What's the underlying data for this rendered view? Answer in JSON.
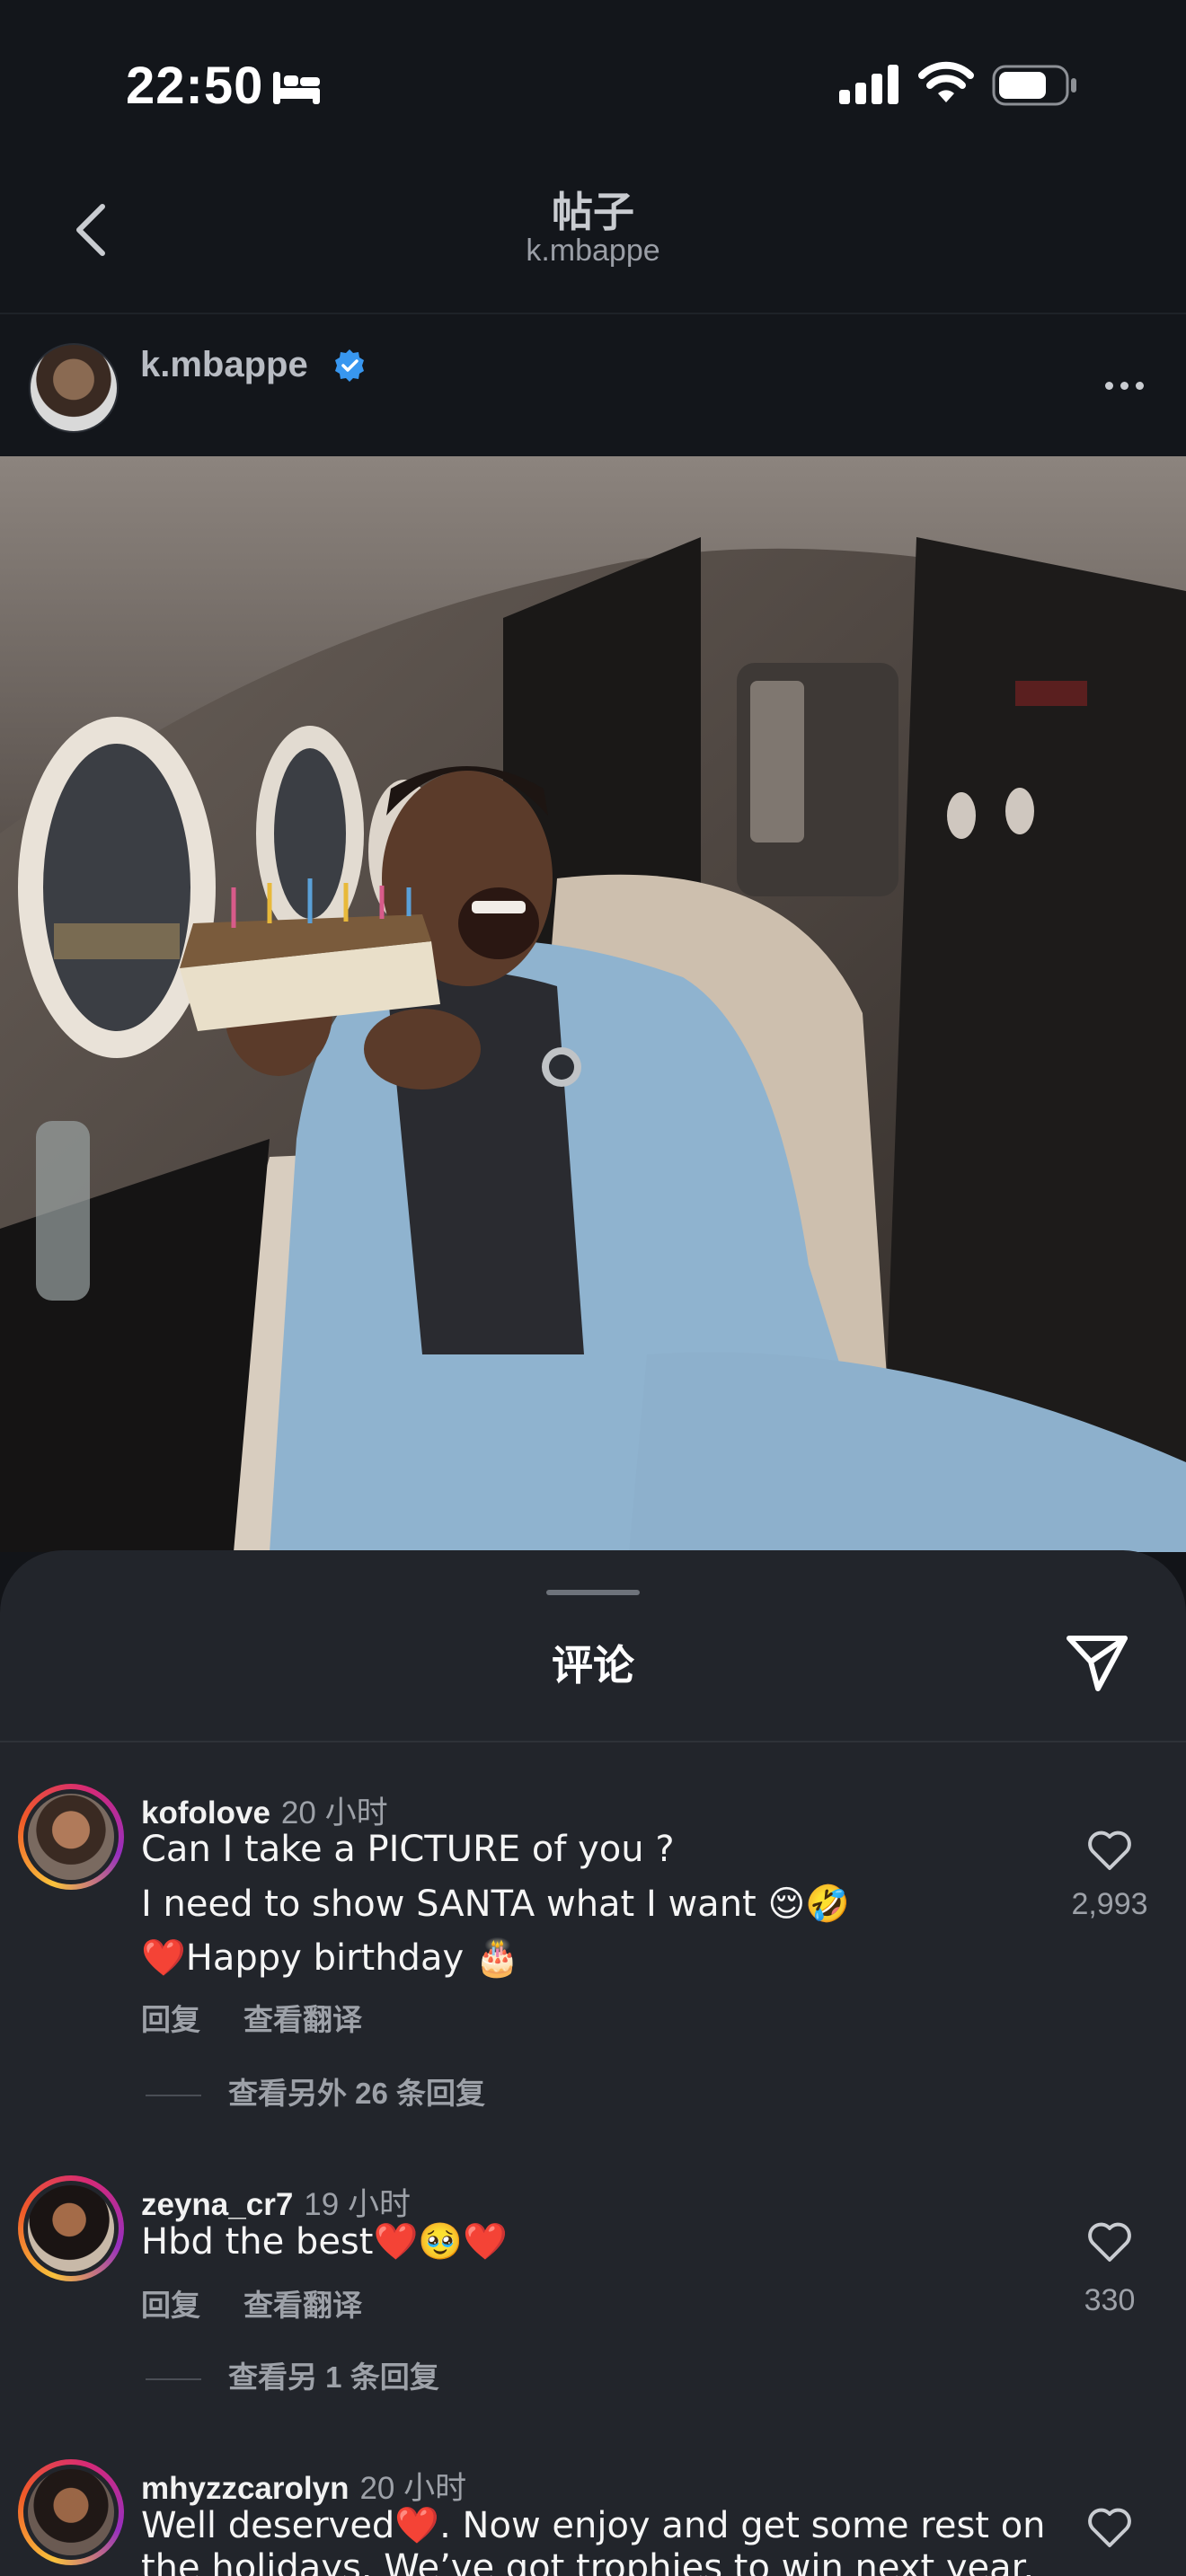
{
  "status_bar": {
    "time": "22:50"
  },
  "nav": {
    "title": "帖子",
    "subtitle": "k.mbappe"
  },
  "post": {
    "author": "k.mbappe"
  },
  "comments_sheet": {
    "title": "评论",
    "comments": [
      {
        "user": "kofolove",
        "time": "20 小时",
        "lines": [
          "Can I take a PICTURE of you ?",
          "I need to show SANTA what I want 😌🤣",
          "❤️Happy birthday 🎂"
        ],
        "likes": "2,993",
        "reply_label": "回复",
        "translate_label": "查看翻译",
        "more_replies": "查看另外 26 条回复"
      },
      {
        "user": "zeyna_cr7",
        "time": "19 小时",
        "lines": [
          "Hbd the best❤️🥹❤️"
        ],
        "likes": "330",
        "reply_label": "回复",
        "translate_label": "查看翻译",
        "more_replies": "查看另 1 条回复"
      },
      {
        "user": "mhyzzcarolyn",
        "time": "20 小时",
        "lines": [
          "Well deserved❤️. Now enjoy and get some rest on",
          "the holidays. We’ve got trophies to win next year."
        ]
      }
    ]
  },
  "colors": {
    "background": "#121418",
    "sheet": "#22252b",
    "verified": "#3897f0"
  },
  "icons": [
    "back-chevron",
    "verified-badge",
    "more-dots",
    "share-paper-plane",
    "heart-outline",
    "signal-bars",
    "wifi",
    "battery",
    "sleep-bed"
  ]
}
